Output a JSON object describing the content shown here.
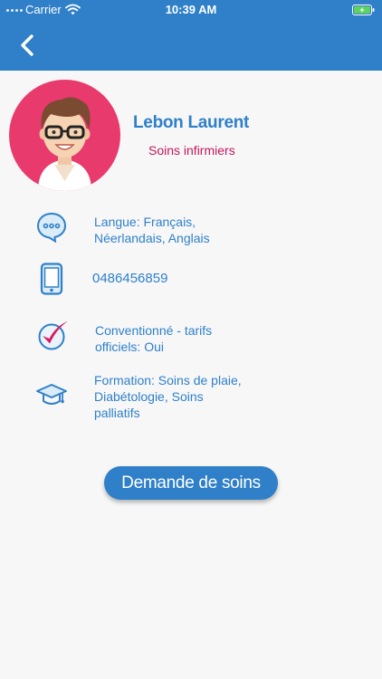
{
  "status_bar": {
    "carrier": "Carrier",
    "time": "10:39 AM"
  },
  "header": {
    "back_icon": "chevron-left-icon",
    "color": "#2f80c8"
  },
  "profile": {
    "name": "Lebon Laurent",
    "specialty": "Soins infirmiers",
    "avatar_background": "#e83a6d"
  },
  "info_items": [
    {
      "icon": "speech-bubble-icon",
      "lines": [
        "Langue: Français,",
        "Néerlandais, Anglais"
      ]
    },
    {
      "icon": "phone-icon",
      "lines": [
        "0486456859"
      ]
    },
    {
      "icon": "checkmark-icon",
      "lines": [
        "Conventionné - tarifs",
        "officiels: Oui"
      ]
    },
    {
      "icon": "graduation-cap-icon",
      "lines": [
        "Formation: Soins de plaie,",
        "Diabétologie, Soins",
        "palliatifs"
      ]
    }
  ],
  "cta": {
    "label": "Demande de soins"
  },
  "colors": {
    "accent": "#2f80c8",
    "specialty_text": "#c2185b",
    "background": "#f7f7f8"
  }
}
